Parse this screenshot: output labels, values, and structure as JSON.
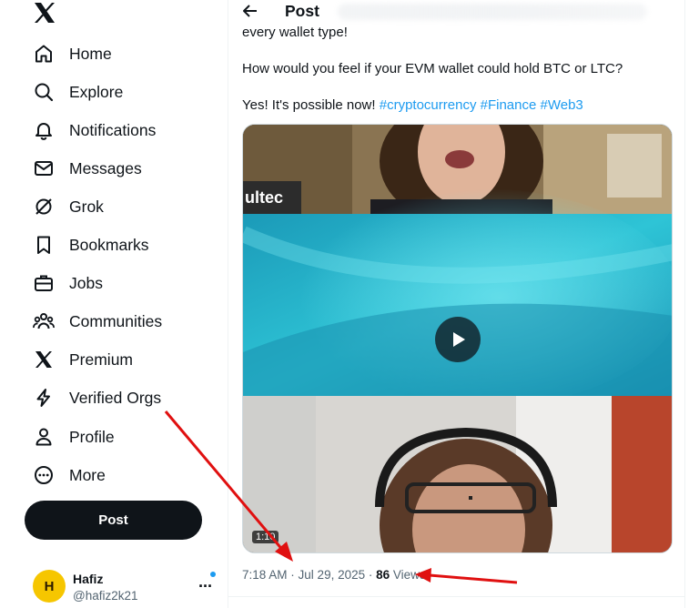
{
  "sidebar": {
    "logo_icon": "x-logo-icon",
    "items": [
      {
        "label": "Home",
        "icon": "home-icon"
      },
      {
        "label": "Explore",
        "icon": "search-icon"
      },
      {
        "label": "Notifications",
        "icon": "bell-icon"
      },
      {
        "label": "Messages",
        "icon": "envelope-icon"
      },
      {
        "label": "Grok",
        "icon": "grok-icon"
      },
      {
        "label": "Bookmarks",
        "icon": "bookmark-icon"
      },
      {
        "label": "Jobs",
        "icon": "briefcase-icon"
      },
      {
        "label": "Communities",
        "icon": "communities-icon"
      },
      {
        "label": "Premium",
        "icon": "x-premium-icon"
      },
      {
        "label": "Verified Orgs",
        "icon": "lightning-icon"
      },
      {
        "label": "Profile",
        "icon": "person-icon"
      },
      {
        "label": "More",
        "icon": "more-circle-icon"
      }
    ],
    "post_button": "Post",
    "account": {
      "name": "Hafiz",
      "handle": "@hafiz2k21",
      "avatar_initial": "H"
    }
  },
  "header": {
    "title": "Post",
    "back_icon": "arrow-left-icon"
  },
  "post": {
    "line1": "every wallet type!",
    "line2": "How would you feel if your EVM wallet could hold BTC or LTC?",
    "line3_text": "Yes! It's possible now!",
    "hashtags": [
      "#cryptocurrency",
      "#Finance",
      "#Web3"
    ],
    "media": {
      "overlay_text": "ultec",
      "duration": "1:10",
      "play_icon": "play-icon"
    },
    "time": "7:18 AM",
    "date": "Jul 29, 2025",
    "views_count": "86",
    "views_label": "Views"
  },
  "colors": {
    "accent": "#1d9bf0",
    "text": "#0f1419",
    "muted": "#536471",
    "annotation": "#e01010"
  }
}
